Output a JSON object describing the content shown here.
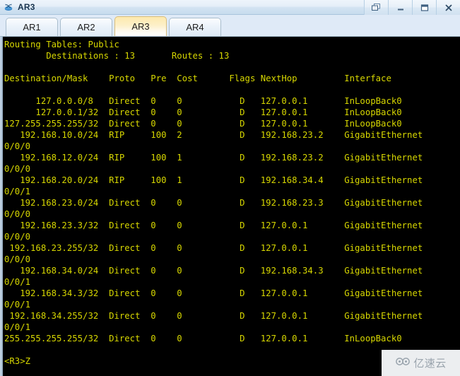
{
  "window": {
    "title": "AR3",
    "icon": "router-icon",
    "controls": [
      {
        "name": "restore-window-button",
        "glyph": "restore-icon"
      },
      {
        "name": "minimize-window-button",
        "glyph": "minimize-icon"
      },
      {
        "name": "maximize-window-button",
        "glyph": "maximize-icon"
      },
      {
        "name": "close-window-button",
        "glyph": "close-icon"
      }
    ]
  },
  "tabs": {
    "items": [
      {
        "label": "AR1",
        "active": false
      },
      {
        "label": "AR2",
        "active": false
      },
      {
        "label": "AR3",
        "active": true
      },
      {
        "label": "AR4",
        "active": false
      }
    ],
    "active_index": 2
  },
  "terminal": {
    "foreground_color": "#d7d700",
    "background_color": "#000000",
    "lines": [
      "Routing Tables: Public",
      "        Destinations : 13       Routes : 13",
      "",
      "Destination/Mask    Proto   Pre  Cost      Flags NextHop         Interface",
      "",
      "      127.0.0.0/8   Direct  0    0           D   127.0.0.1       InLoopBack0",
      "      127.0.0.1/32  Direct  0    0           D   127.0.0.1       InLoopBack0",
      "127.255.255.255/32  Direct  0    0           D   127.0.0.1       InLoopBack0",
      "   192.168.10.0/24  RIP     100  2           D   192.168.23.2    GigabitEthernet",
      "0/0/0",
      "   192.168.12.0/24  RIP     100  1           D   192.168.23.2    GigabitEthernet",
      "0/0/0",
      "   192.168.20.0/24  RIP     100  1           D   192.168.34.4    GigabitEthernet",
      "0/0/1",
      "   192.168.23.0/24  Direct  0    0           D   192.168.23.3    GigabitEthernet",
      "0/0/0",
      "   192.168.23.3/32  Direct  0    0           D   127.0.0.1       GigabitEthernet",
      "0/0/0",
      " 192.168.23.255/32  Direct  0    0           D   127.0.0.1       GigabitEthernet",
      "0/0/0",
      "   192.168.34.0/24  Direct  0    0           D   192.168.34.3    GigabitEthernet",
      "0/0/1",
      "   192.168.34.3/32  Direct  0    0           D   127.0.0.1       GigabitEthernet",
      "0/0/1",
      " 192.168.34.255/32  Direct  0    0           D   127.0.0.1       GigabitEthernet",
      "0/0/1",
      "255.255.255.255/32  Direct  0    0           D   127.0.0.1       InLoopBack0",
      "",
      "<R3>Z"
    ],
    "routing_table": {
      "title": "Routing Tables: Public",
      "destinations": "13",
      "routes": "13",
      "columns": [
        "Destination/Mask",
        "Proto",
        "Pre",
        "Cost",
        "Flags",
        "NextHop",
        "Interface"
      ],
      "rows": [
        {
          "destination": "127.0.0.0/8",
          "proto": "Direct",
          "pre": "0",
          "cost": "0",
          "flags": "D",
          "nexthop": "127.0.0.1",
          "interface": "InLoopBack0"
        },
        {
          "destination": "127.0.0.1/32",
          "proto": "Direct",
          "pre": "0",
          "cost": "0",
          "flags": "D",
          "nexthop": "127.0.0.1",
          "interface": "InLoopBack0"
        },
        {
          "destination": "127.255.255.255/32",
          "proto": "Direct",
          "pre": "0",
          "cost": "0",
          "flags": "D",
          "nexthop": "127.0.0.1",
          "interface": "InLoopBack0"
        },
        {
          "destination": "192.168.10.0/24",
          "proto": "RIP",
          "pre": "100",
          "cost": "2",
          "flags": "D",
          "nexthop": "192.168.23.2",
          "interface": "GigabitEthernet0/0/0"
        },
        {
          "destination": "192.168.12.0/24",
          "proto": "RIP",
          "pre": "100",
          "cost": "1",
          "flags": "D",
          "nexthop": "192.168.23.2",
          "interface": "GigabitEthernet0/0/0"
        },
        {
          "destination": "192.168.20.0/24",
          "proto": "RIP",
          "pre": "100",
          "cost": "1",
          "flags": "D",
          "nexthop": "192.168.34.4",
          "interface": "GigabitEthernet0/0/1"
        },
        {
          "destination": "192.168.23.0/24",
          "proto": "Direct",
          "pre": "0",
          "cost": "0",
          "flags": "D",
          "nexthop": "192.168.23.3",
          "interface": "GigabitEthernet0/0/0"
        },
        {
          "destination": "192.168.23.3/32",
          "proto": "Direct",
          "pre": "0",
          "cost": "0",
          "flags": "D",
          "nexthop": "127.0.0.1",
          "interface": "GigabitEthernet0/0/0"
        },
        {
          "destination": "192.168.23.255/32",
          "proto": "Direct",
          "pre": "0",
          "cost": "0",
          "flags": "D",
          "nexthop": "127.0.0.1",
          "interface": "GigabitEthernet0/0/0"
        },
        {
          "destination": "192.168.34.0/24",
          "proto": "Direct",
          "pre": "0",
          "cost": "0",
          "flags": "D",
          "nexthop": "192.168.34.3",
          "interface": "GigabitEthernet0/0/1"
        },
        {
          "destination": "192.168.34.3/32",
          "proto": "Direct",
          "pre": "0",
          "cost": "0",
          "flags": "D",
          "nexthop": "127.0.0.1",
          "interface": "GigabitEthernet0/0/1"
        },
        {
          "destination": "192.168.34.255/32",
          "proto": "Direct",
          "pre": "0",
          "cost": "0",
          "flags": "D",
          "nexthop": "127.0.0.1",
          "interface": "GigabitEthernet0/0/1"
        },
        {
          "destination": "255.255.255.255/32",
          "proto": "Direct",
          "pre": "0",
          "cost": "0",
          "flags": "D",
          "nexthop": "127.0.0.1",
          "interface": "InLoopBack0"
        }
      ]
    },
    "prompt": "<R3>Z"
  },
  "watermark": {
    "text": "亿速云",
    "icon": "cloud-icon"
  }
}
